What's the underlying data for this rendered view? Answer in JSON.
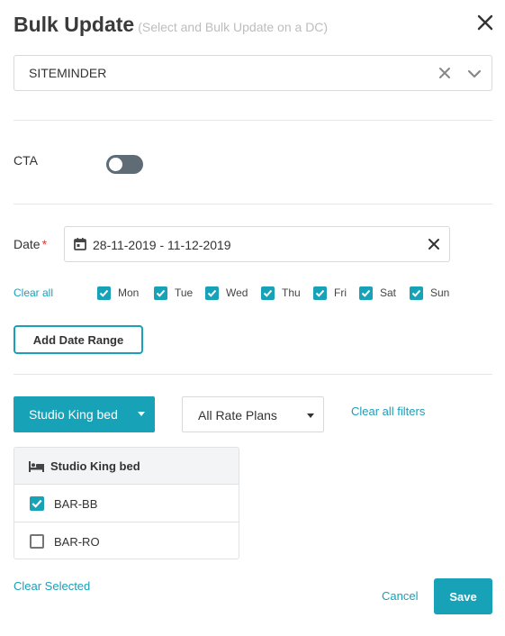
{
  "header": {
    "title": "Bulk Update",
    "subtitle": "(Select and Bulk Update on a DC)",
    "close_icon": "close-icon"
  },
  "channel": {
    "value": "SITEMINDER",
    "clear_icon": "clear-icon",
    "dropdown_icon": "chevron-down-icon"
  },
  "cta": {
    "label": "CTA",
    "enabled": false
  },
  "date": {
    "label": "Date",
    "required_mark": "*",
    "value": "28-11-2019 - 11-12-2019",
    "calendar_icon": "calendar-icon",
    "clear_icon": "close-icon"
  },
  "days": {
    "clear_all": "Clear all",
    "items": [
      {
        "label": "Mon",
        "checked": true
      },
      {
        "label": "Tue",
        "checked": true
      },
      {
        "label": "Wed",
        "checked": true
      },
      {
        "label": "Thu",
        "checked": true
      },
      {
        "label": "Fri",
        "checked": true
      },
      {
        "label": "Sat",
        "checked": true
      },
      {
        "label": "Sun",
        "checked": true
      }
    ]
  },
  "add_date_range": "Add Date Range",
  "filters": {
    "room_type": "Studio King bed",
    "rate_plans": "All Rate Plans",
    "clear_filters": "Clear all filters"
  },
  "room_panel": {
    "title": "Studio King bed",
    "icon": "bed-icon",
    "plans": [
      {
        "label": "BAR-BB",
        "checked": true
      },
      {
        "label": "BAR-RO",
        "checked": false
      }
    ]
  },
  "footer": {
    "clear_selected": "Clear Selected",
    "cancel": "Cancel",
    "save": "Save"
  },
  "colors": {
    "accent": "#17a2b8",
    "link": "#1aa0b8",
    "toggle_off": "#5f6b75",
    "required": "#e53935"
  }
}
